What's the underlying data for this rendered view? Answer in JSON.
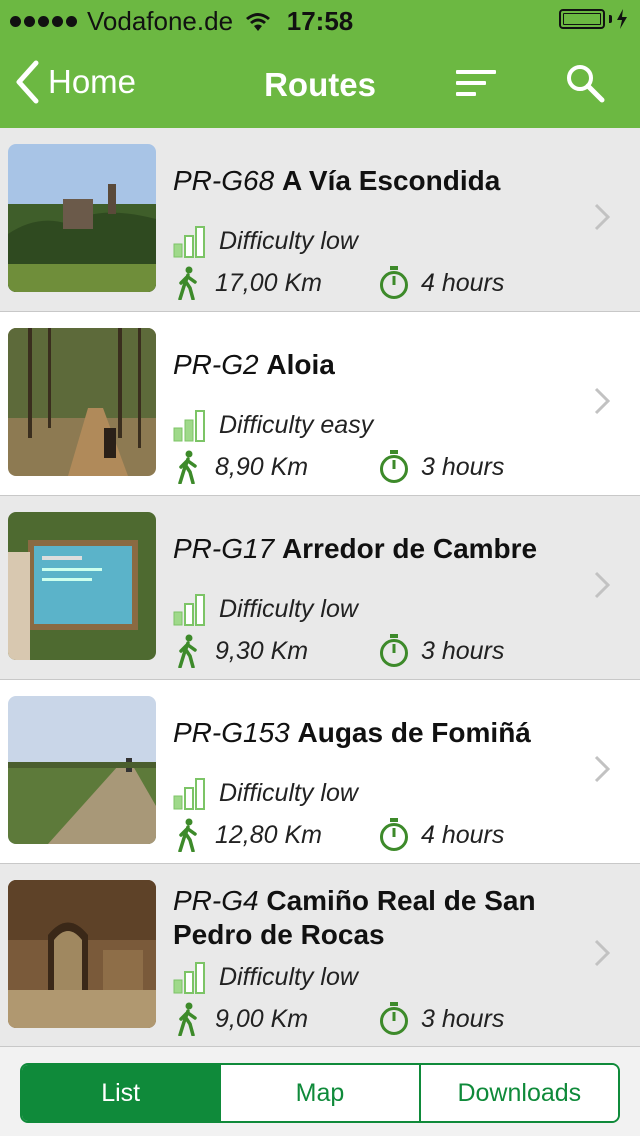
{
  "status_bar": {
    "carrier": "Vodafone.de",
    "time": "17:58",
    "icons": [
      "signal-dots-icon",
      "wifi-icon",
      "battery-icon",
      "charging-bolt-icon"
    ]
  },
  "nav": {
    "back_label": "Home",
    "title": "Routes",
    "icons": [
      "back-chevron-icon",
      "sort-lines-icon",
      "search-icon"
    ]
  },
  "routes": [
    {
      "code": "PR-G68",
      "name": "A Vía Escondida",
      "difficulty": "Difficulty low",
      "distance": "17,00 Km",
      "duration": "4 hours"
    },
    {
      "code": "PR-G2",
      "name": "Aloia",
      "difficulty": "Difficulty easy",
      "distance": "8,90 Km",
      "duration": "3 hours"
    },
    {
      "code": "PR-G17",
      "name": "Arredor de Cambre",
      "difficulty": "Difficulty low",
      "distance": "9,30 Km",
      "duration": "3 hours"
    },
    {
      "code": "PR-G153",
      "name": "Augas de Fomiñá",
      "difficulty": "Difficulty low",
      "distance": "12,80 Km",
      "duration": "4 hours"
    },
    {
      "code": "PR-G4",
      "name": "Camiño Real de San Pedro de Rocas",
      "difficulty": "Difficulty low",
      "distance": "9,00 Km",
      "duration": "3 hours"
    }
  ],
  "tabs": [
    {
      "label": "List",
      "active": true
    },
    {
      "label": "Map",
      "active": false
    },
    {
      "label": "Downloads",
      "active": false
    }
  ],
  "colors": {
    "header_green": "#6cb842",
    "accent_green": "#0f8a3a",
    "icon_green": "#3d8a2a",
    "bar_light_green": "#9fd98a",
    "row_alt": "#e9e9e9"
  }
}
